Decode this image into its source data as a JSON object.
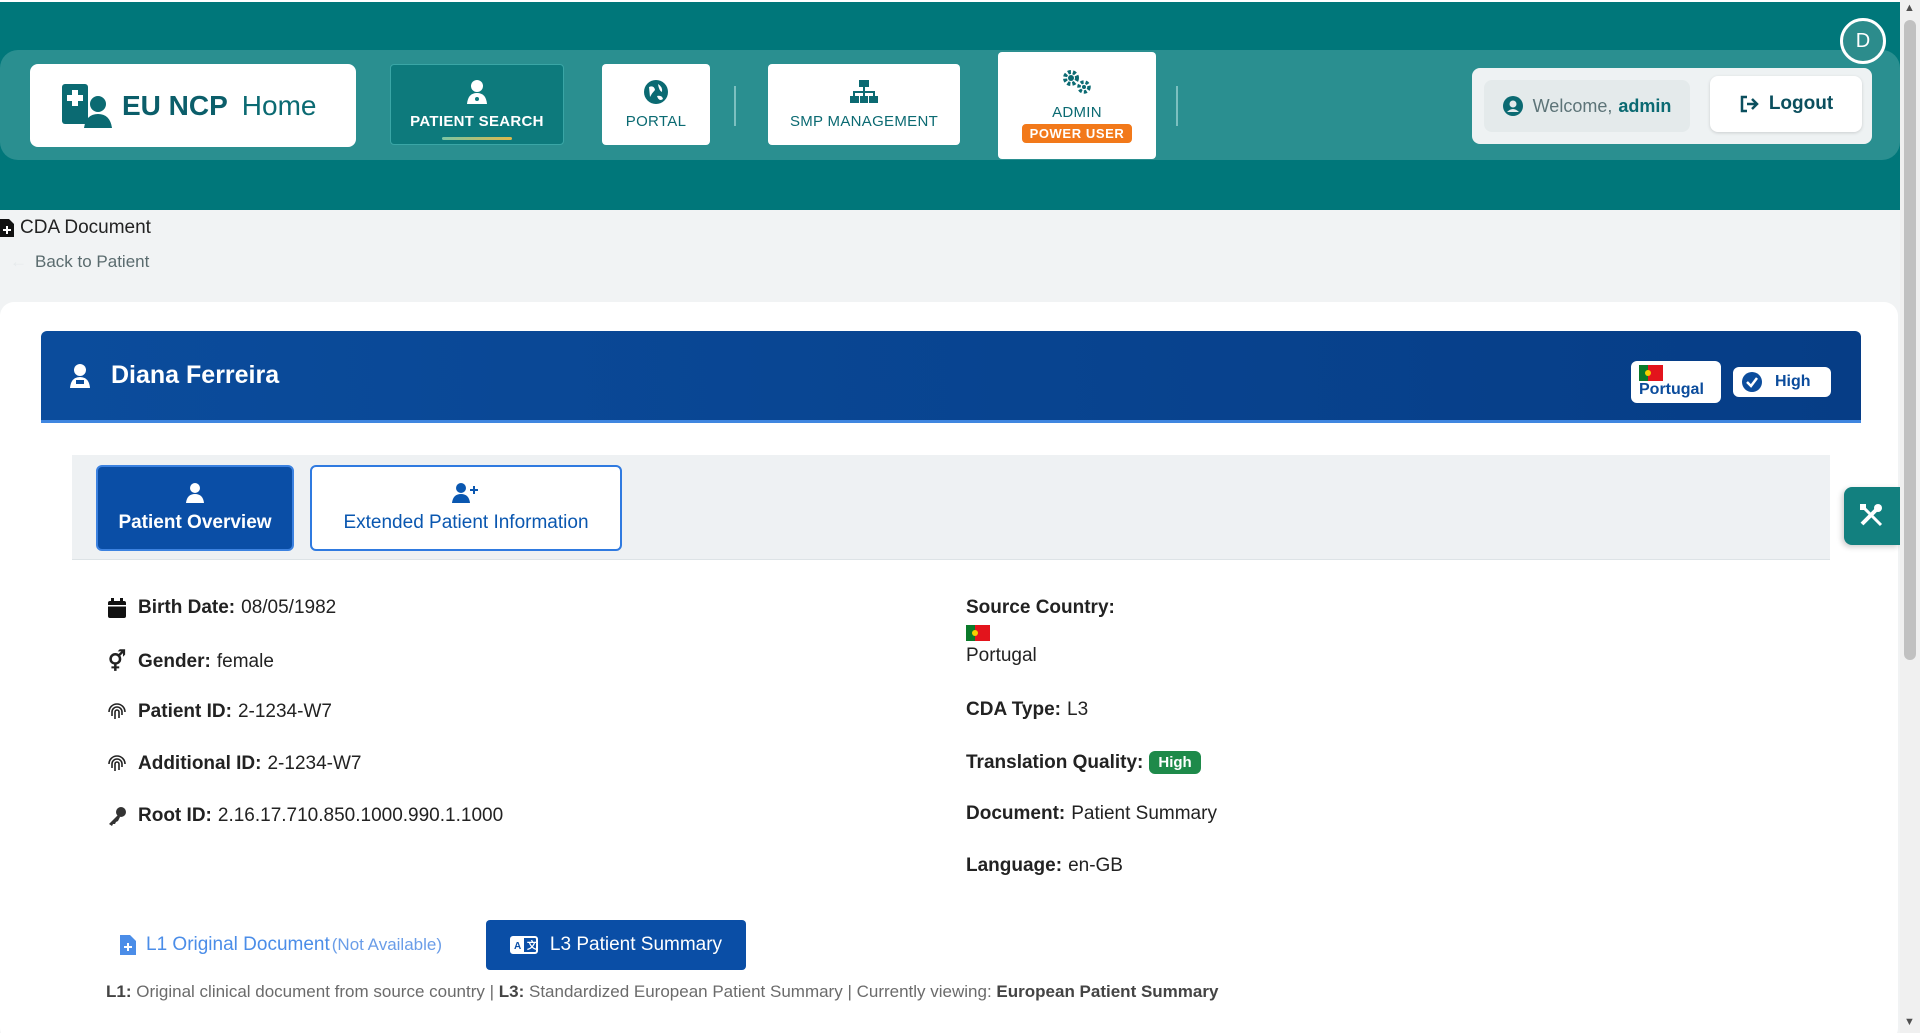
{
  "header": {
    "brand_ncp": "EU NCP",
    "brand_home": "Home",
    "nav": {
      "patient_search": "PATIENT SEARCH",
      "portal": "PORTAL",
      "smp_management": "SMP MANAGEMENT",
      "admin": "ADMIN",
      "power_user": "POWER USER"
    },
    "welcome_prefix": "Welcome,",
    "welcome_user": "admin",
    "logout": "Logout",
    "avatar_initial": "D"
  },
  "breadcrumb": {
    "title": "CDA Document",
    "back": "Back to Patient"
  },
  "patient": {
    "name": "Diana Ferreira",
    "country_badge": "Portugal",
    "quality_badge": "High"
  },
  "tabs": {
    "overview": "Patient Overview",
    "extended": "Extended Patient Information"
  },
  "left_info": {
    "birth_label": "Birth Date:",
    "birth_value": "08/05/1982",
    "gender_label": "Gender:",
    "gender_value": "female",
    "patient_id_label": "Patient ID:",
    "patient_id_value": "2-1234-W7",
    "additional_id_label": "Additional ID:",
    "additional_id_value": "2-1234-W7",
    "root_id_label": "Root ID:",
    "root_id_value": "2.16.17.710.850.1000.990.1.1000"
  },
  "right_info": {
    "source_country_label": "Source Country:",
    "source_country_value": "Portugal",
    "cda_type_label": "CDA Type:",
    "cda_type_value": "L3",
    "translation_quality_label": "Translation Quality:",
    "translation_quality_value": "High",
    "document_label": "Document:",
    "document_value": "Patient Summary",
    "language_label": "Language:",
    "language_value": "en-GB"
  },
  "doc_tabs": {
    "l1_label": "L1 Original Document",
    "l1_note": "(Not Available)",
    "l3_label": "L3 Patient Summary"
  },
  "legend": {
    "l1_key": "L1:",
    "l1_text": "Original clinical document from source country |",
    "l3_key": "L3:",
    "l3_text": "Standardized European Patient Summary | Currently viewing:",
    "current": "European Patient Summary"
  },
  "colors": {
    "header_teal": "#00777a",
    "patient_blue": "#0b4c9c",
    "badge_green": "#1e8a4a",
    "power_orange": "#f2791a"
  }
}
